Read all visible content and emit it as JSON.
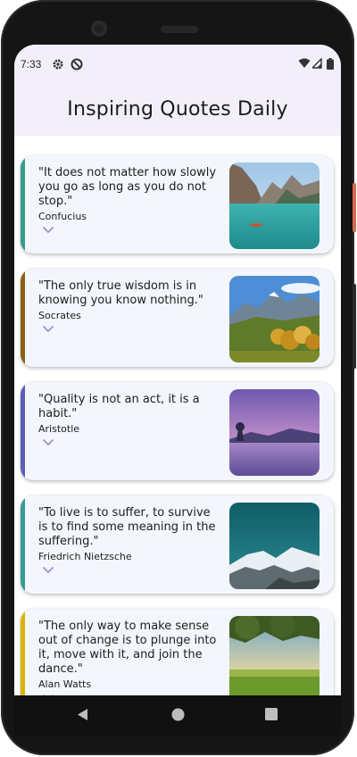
{
  "status_bar": {
    "time": "7:33"
  },
  "app_bar": {
    "title": "Inspiring Quotes Daily"
  },
  "quotes": [
    {
      "quote": "\"It does not matter how slowly you go as long as you do not stop.\"",
      "author": "Confucius",
      "accent": "#3a9a8e"
    },
    {
      "quote": "\"The only true wisdom is in knowing you know nothing.\"",
      "author": "Socrates",
      "accent": "#8a6114"
    },
    {
      "quote": "\"Quality is not an act, it is a habit.\"",
      "author": "Aristotle",
      "accent": "#5a5cb8"
    },
    {
      "quote": "\"To live is to suffer, to survive is to find some meaning in the suffering.\"",
      "author": "Friedrich Nietzsche",
      "accent": "#3a9898"
    },
    {
      "quote": "\"The only way to make sense out of change is to plunge into it, move with it, and join the dance.\"",
      "author": "Alan Watts",
      "accent": "#d8b400"
    }
  ]
}
